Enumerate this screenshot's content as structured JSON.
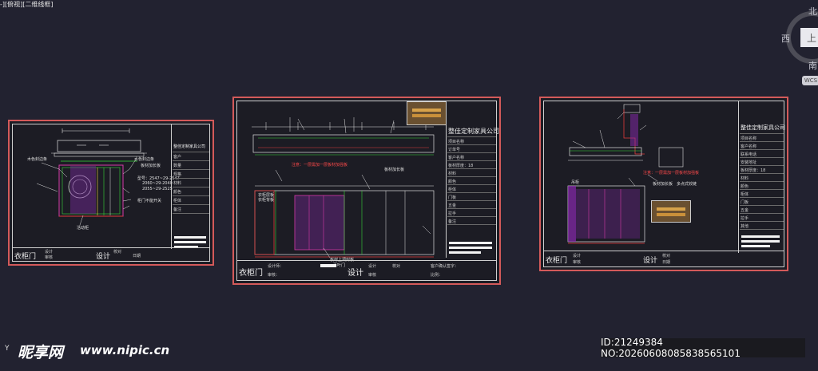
{
  "viewport": {
    "label": "-][俯视][二维线框]"
  },
  "viewcube": {
    "north": "北",
    "west": "西",
    "south": "南",
    "top_face": "上",
    "wcs": "WCS"
  },
  "company": "整佳定制家具公司",
  "sheets": [
    {
      "name": "衣柜门",
      "design": "设计",
      "company": "整佳定制家具公司",
      "annotations": [
        "木色封边条",
        "水色封边条",
        "板材加长板",
        "型号：2547~29-2547",
        "2060~29-2040",
        "2055~29-2525",
        "柜门不能开关",
        "活动柜"
      ],
      "tb_labels": [
        "衣柜门",
        "客户",
        "数量",
        "规格",
        "材料",
        "颜色",
        "柜体",
        "备注",
        "设计",
        "审核",
        "校对",
        "日期"
      ]
    },
    {
      "name": "衣柜门",
      "design": "设计",
      "company": "整佳定制家具公司",
      "annotations": [
        "板材加长板",
        "板材上调封板",
        "百叶门",
        "衣柜层板",
        "衣柜背板"
      ],
      "red_note": "注意：一层需加一层板材加强板",
      "tb_labels": [
        "衣柜门",
        "项目名称",
        "订单号",
        "客户名称",
        "板材厚度：18",
        "材料",
        "颜色",
        "柜体",
        "门板",
        "五金",
        "拉手",
        "备注",
        "设计",
        "审核",
        "校对",
        "日期"
      ],
      "bottom": {
        "design_person": "设计师：",
        "review": "审核：",
        "customer": "客户确认签字：",
        "scale": "比例："
      }
    },
    {
      "name": "衣柜门",
      "design": "设计",
      "company": "整佳定制家具公司",
      "annotations": [
        "板材加长板",
        "多点式铰链",
        "吊柜"
      ],
      "red_note": "注意：一层需加一层板材加强板",
      "tb_labels": [
        "项目名称",
        "客户名称",
        "联系电话",
        "安装地址",
        "板材厚度：18",
        "材料",
        "颜色",
        "柜体",
        "门板",
        "五金",
        "拉手",
        "其他",
        "备注",
        "设计",
        "审核",
        "校对",
        "日期"
      ]
    }
  ],
  "watermark": {
    "logo": "昵享网",
    "url": "www.nipic.cn",
    "id": "ID:21249384 NO:20260608085838565101"
  },
  "ucs": "Y"
}
